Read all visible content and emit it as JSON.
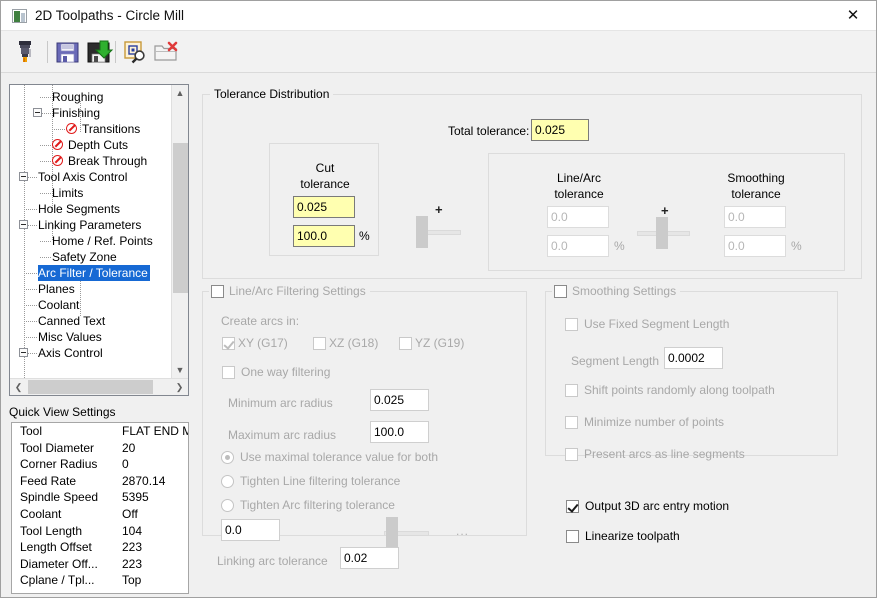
{
  "window": {
    "title": "2D Toolpaths - Circle Mill",
    "close_label": "✕",
    "icon": "toolpath-window-icon"
  },
  "toolbar": {
    "buttons": [
      {
        "name": "tool-select-button",
        "icon": "end-mill-icon"
      },
      {
        "name": "save-button",
        "icon": "floppy-disk-icon"
      },
      {
        "name": "save-to-library-button",
        "icon": "floppy-disk-down-arrow-icon"
      },
      {
        "name": "select-library-tool-button",
        "icon": "magnifier-frame-icon"
      },
      {
        "name": "delete-from-library-button",
        "icon": "folder-delete-icon"
      }
    ]
  },
  "tree": {
    "items": [
      {
        "label": "Roughing",
        "indent": 3,
        "icon": "none",
        "toggle": false
      },
      {
        "label": "Finishing",
        "indent": 3,
        "icon": "none",
        "toggle": true
      },
      {
        "label": "Transitions",
        "indent": 4,
        "icon": "blocked",
        "toggle": false
      },
      {
        "label": "Depth Cuts",
        "indent": 3,
        "icon": "blocked",
        "toggle": false
      },
      {
        "label": "Break Through",
        "indent": 3,
        "icon": "blocked",
        "toggle": false
      },
      {
        "label": "Tool Axis Control",
        "indent": 2,
        "icon": "none",
        "toggle": true
      },
      {
        "label": "Limits",
        "indent": 3,
        "icon": "none",
        "toggle": false
      },
      {
        "label": "Hole Segments",
        "indent": 2,
        "icon": "none",
        "toggle": false
      },
      {
        "label": "Linking Parameters",
        "indent": 2,
        "icon": "none",
        "toggle": true
      },
      {
        "label": "Home / Ref. Points",
        "indent": 3,
        "icon": "none",
        "toggle": false
      },
      {
        "label": "Safety Zone",
        "indent": 3,
        "icon": "none",
        "toggle": false
      },
      {
        "label": "Arc Filter / Tolerance",
        "indent": 2,
        "icon": "none",
        "toggle": false,
        "selected": true
      },
      {
        "label": "Planes",
        "indent": 2,
        "icon": "none",
        "toggle": false
      },
      {
        "label": "Coolant",
        "indent": 2,
        "icon": "none",
        "toggle": false
      },
      {
        "label": "Canned Text",
        "indent": 2,
        "icon": "none",
        "toggle": false
      },
      {
        "label": "Misc Values",
        "indent": 2,
        "icon": "none",
        "toggle": false
      },
      {
        "label": "Axis Control",
        "indent": 2,
        "icon": "none",
        "toggle": true
      }
    ],
    "scroll_up": "▲",
    "scroll_down": "▼",
    "scroll_left": "❮",
    "scroll_right": "❯"
  },
  "quick_view": {
    "title": "Quick View Settings",
    "rows": [
      {
        "key": "Tool",
        "value": "FLAT END MI..."
      },
      {
        "key": "Tool Diameter",
        "value": "20"
      },
      {
        "key": "Corner Radius",
        "value": "0"
      },
      {
        "key": "Feed Rate",
        "value": "2870.14"
      },
      {
        "key": "Spindle Speed",
        "value": "5395"
      },
      {
        "key": "Coolant",
        "value": "Off"
      },
      {
        "key": "Tool Length",
        "value": "104"
      },
      {
        "key": "Length Offset",
        "value": "223"
      },
      {
        "key": "Diameter Off...",
        "value": "223"
      },
      {
        "key": "Cplane / Tpl...",
        "value": "Top"
      }
    ]
  },
  "tolerance_distribution": {
    "group_label": "Tolerance Distribution",
    "total_tolerance_label": "Total tolerance:",
    "total_tolerance_value": "0.025",
    "cut": {
      "title_line1": "Cut",
      "title_line2": "tolerance",
      "value": "0.025",
      "percent": "100.0",
      "percent_symbol": "%"
    },
    "plus_left": "+",
    "plus_right": "+",
    "line_arc": {
      "title_line1": "Line/Arc",
      "title_line2": "tolerance",
      "value": "0.0",
      "percent": "0.0",
      "percent_symbol": "%"
    },
    "smoothing": {
      "title_line1": "Smoothing",
      "title_line2": "tolerance",
      "value": "0.0",
      "percent": "0.0",
      "percent_symbol": "%"
    }
  },
  "line_arc_filtering": {
    "group_label": "Line/Arc Filtering Settings",
    "group_checked": false,
    "create_arcs_label": "Create arcs in:",
    "planes": [
      {
        "label": "XY (G17)",
        "checked": true
      },
      {
        "label": "XZ (G18)",
        "checked": false
      },
      {
        "label": "YZ (G19)",
        "checked": false
      }
    ],
    "one_way_filtering": {
      "label": "One way filtering",
      "checked": false
    },
    "min_arc_radius": {
      "label": "Minimum arc radius",
      "value": "0.025"
    },
    "max_arc_radius": {
      "label": "Maximum arc radius",
      "value": "100.0"
    },
    "radios": [
      {
        "label": "Use maximal tolerance value for both",
        "selected": true
      },
      {
        "label": "Tighten Line filtering tolerance",
        "selected": false
      },
      {
        "label": "Tighten Arc filtering tolerance",
        "selected": false
      }
    ],
    "tighten_value": "0.0",
    "ellipsis": "..."
  },
  "linking_arc_tolerance": {
    "label": "Linking arc tolerance",
    "value": "0.02"
  },
  "smoothing_settings": {
    "group_label": "Smoothing Settings",
    "group_checked": false,
    "use_fixed_segment_length": {
      "label": "Use Fixed Segment Length",
      "checked": false
    },
    "segment_length": {
      "label": "Segment Length",
      "value": "0.0002"
    },
    "options": [
      {
        "label": "Shift points randomly along toolpath",
        "checked": false
      },
      {
        "label": "Minimize number of points",
        "checked": false
      },
      {
        "label": "Present arcs as line segments",
        "checked": false
      }
    ]
  },
  "output_options": [
    {
      "label": "Output 3D arc entry motion",
      "checked": true
    },
    {
      "label": "Linearize toolpath",
      "checked": false
    }
  ],
  "colors": {
    "highlight": "#1669d4",
    "field_active": "#ffffb0",
    "blocked_icon": "#e01b1b",
    "window_bg": "#f0f0f0"
  }
}
